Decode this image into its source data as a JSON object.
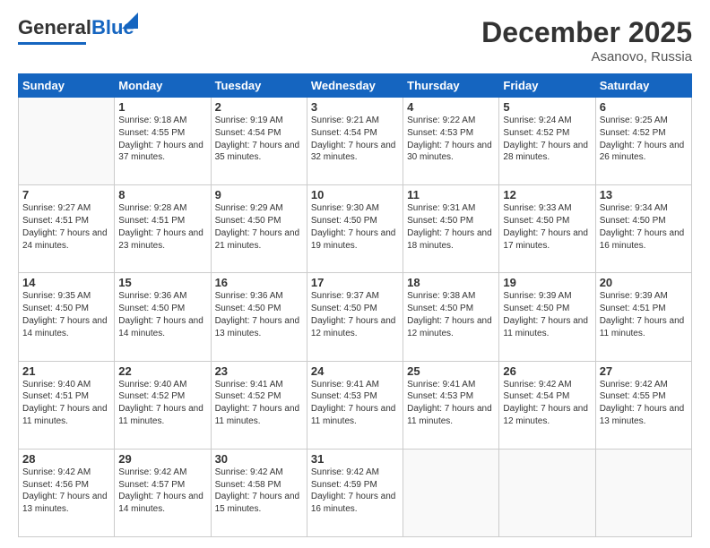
{
  "logo": {
    "general": "General",
    "blue": "Blue"
  },
  "header": {
    "month_year": "December 2025",
    "location": "Asanovo, Russia"
  },
  "days_of_week": [
    "Sunday",
    "Monday",
    "Tuesday",
    "Wednesday",
    "Thursday",
    "Friday",
    "Saturday"
  ],
  "weeks": [
    [
      {
        "day": "",
        "sunrise": "",
        "sunset": "",
        "daylight": ""
      },
      {
        "day": "1",
        "sunrise": "Sunrise: 9:18 AM",
        "sunset": "Sunset: 4:55 PM",
        "daylight": "Daylight: 7 hours and 37 minutes."
      },
      {
        "day": "2",
        "sunrise": "Sunrise: 9:19 AM",
        "sunset": "Sunset: 4:54 PM",
        "daylight": "Daylight: 7 hours and 35 minutes."
      },
      {
        "day": "3",
        "sunrise": "Sunrise: 9:21 AM",
        "sunset": "Sunset: 4:54 PM",
        "daylight": "Daylight: 7 hours and 32 minutes."
      },
      {
        "day": "4",
        "sunrise": "Sunrise: 9:22 AM",
        "sunset": "Sunset: 4:53 PM",
        "daylight": "Daylight: 7 hours and 30 minutes."
      },
      {
        "day": "5",
        "sunrise": "Sunrise: 9:24 AM",
        "sunset": "Sunset: 4:52 PM",
        "daylight": "Daylight: 7 hours and 28 minutes."
      },
      {
        "day": "6",
        "sunrise": "Sunrise: 9:25 AM",
        "sunset": "Sunset: 4:52 PM",
        "daylight": "Daylight: 7 hours and 26 minutes."
      }
    ],
    [
      {
        "day": "7",
        "sunrise": "Sunrise: 9:27 AM",
        "sunset": "Sunset: 4:51 PM",
        "daylight": "Daylight: 7 hours and 24 minutes."
      },
      {
        "day": "8",
        "sunrise": "Sunrise: 9:28 AM",
        "sunset": "Sunset: 4:51 PM",
        "daylight": "Daylight: 7 hours and 23 minutes."
      },
      {
        "day": "9",
        "sunrise": "Sunrise: 9:29 AM",
        "sunset": "Sunset: 4:50 PM",
        "daylight": "Daylight: 7 hours and 21 minutes."
      },
      {
        "day": "10",
        "sunrise": "Sunrise: 9:30 AM",
        "sunset": "Sunset: 4:50 PM",
        "daylight": "Daylight: 7 hours and 19 minutes."
      },
      {
        "day": "11",
        "sunrise": "Sunrise: 9:31 AM",
        "sunset": "Sunset: 4:50 PM",
        "daylight": "Daylight: 7 hours and 18 minutes."
      },
      {
        "day": "12",
        "sunrise": "Sunrise: 9:33 AM",
        "sunset": "Sunset: 4:50 PM",
        "daylight": "Daylight: 7 hours and 17 minutes."
      },
      {
        "day": "13",
        "sunrise": "Sunrise: 9:34 AM",
        "sunset": "Sunset: 4:50 PM",
        "daylight": "Daylight: 7 hours and 16 minutes."
      }
    ],
    [
      {
        "day": "14",
        "sunrise": "Sunrise: 9:35 AM",
        "sunset": "Sunset: 4:50 PM",
        "daylight": "Daylight: 7 hours and 14 minutes."
      },
      {
        "day": "15",
        "sunrise": "Sunrise: 9:36 AM",
        "sunset": "Sunset: 4:50 PM",
        "daylight": "Daylight: 7 hours and 14 minutes."
      },
      {
        "day": "16",
        "sunrise": "Sunrise: 9:36 AM",
        "sunset": "Sunset: 4:50 PM",
        "daylight": "Daylight: 7 hours and 13 minutes."
      },
      {
        "day": "17",
        "sunrise": "Sunrise: 9:37 AM",
        "sunset": "Sunset: 4:50 PM",
        "daylight": "Daylight: 7 hours and 12 minutes."
      },
      {
        "day": "18",
        "sunrise": "Sunrise: 9:38 AM",
        "sunset": "Sunset: 4:50 PM",
        "daylight": "Daylight: 7 hours and 12 minutes."
      },
      {
        "day": "19",
        "sunrise": "Sunrise: 9:39 AM",
        "sunset": "Sunset: 4:50 PM",
        "daylight": "Daylight: 7 hours and 11 minutes."
      },
      {
        "day": "20",
        "sunrise": "Sunrise: 9:39 AM",
        "sunset": "Sunset: 4:51 PM",
        "daylight": "Daylight: 7 hours and 11 minutes."
      }
    ],
    [
      {
        "day": "21",
        "sunrise": "Sunrise: 9:40 AM",
        "sunset": "Sunset: 4:51 PM",
        "daylight": "Daylight: 7 hours and 11 minutes."
      },
      {
        "day": "22",
        "sunrise": "Sunrise: 9:40 AM",
        "sunset": "Sunset: 4:52 PM",
        "daylight": "Daylight: 7 hours and 11 minutes."
      },
      {
        "day": "23",
        "sunrise": "Sunrise: 9:41 AM",
        "sunset": "Sunset: 4:52 PM",
        "daylight": "Daylight: 7 hours and 11 minutes."
      },
      {
        "day": "24",
        "sunrise": "Sunrise: 9:41 AM",
        "sunset": "Sunset: 4:53 PM",
        "daylight": "Daylight: 7 hours and 11 minutes."
      },
      {
        "day": "25",
        "sunrise": "Sunrise: 9:41 AM",
        "sunset": "Sunset: 4:53 PM",
        "daylight": "Daylight: 7 hours and 11 minutes."
      },
      {
        "day": "26",
        "sunrise": "Sunrise: 9:42 AM",
        "sunset": "Sunset: 4:54 PM",
        "daylight": "Daylight: 7 hours and 12 minutes."
      },
      {
        "day": "27",
        "sunrise": "Sunrise: 9:42 AM",
        "sunset": "Sunset: 4:55 PM",
        "daylight": "Daylight: 7 hours and 13 minutes."
      }
    ],
    [
      {
        "day": "28",
        "sunrise": "Sunrise: 9:42 AM",
        "sunset": "Sunset: 4:56 PM",
        "daylight": "Daylight: 7 hours and 13 minutes."
      },
      {
        "day": "29",
        "sunrise": "Sunrise: 9:42 AM",
        "sunset": "Sunset: 4:57 PM",
        "daylight": "Daylight: 7 hours and 14 minutes."
      },
      {
        "day": "30",
        "sunrise": "Sunrise: 9:42 AM",
        "sunset": "Sunset: 4:58 PM",
        "daylight": "Daylight: 7 hours and 15 minutes."
      },
      {
        "day": "31",
        "sunrise": "Sunrise: 9:42 AM",
        "sunset": "Sunset: 4:59 PM",
        "daylight": "Daylight: 7 hours and 16 minutes."
      },
      {
        "day": "",
        "sunrise": "",
        "sunset": "",
        "daylight": ""
      },
      {
        "day": "",
        "sunrise": "",
        "sunset": "",
        "daylight": ""
      },
      {
        "day": "",
        "sunrise": "",
        "sunset": "",
        "daylight": ""
      }
    ]
  ]
}
